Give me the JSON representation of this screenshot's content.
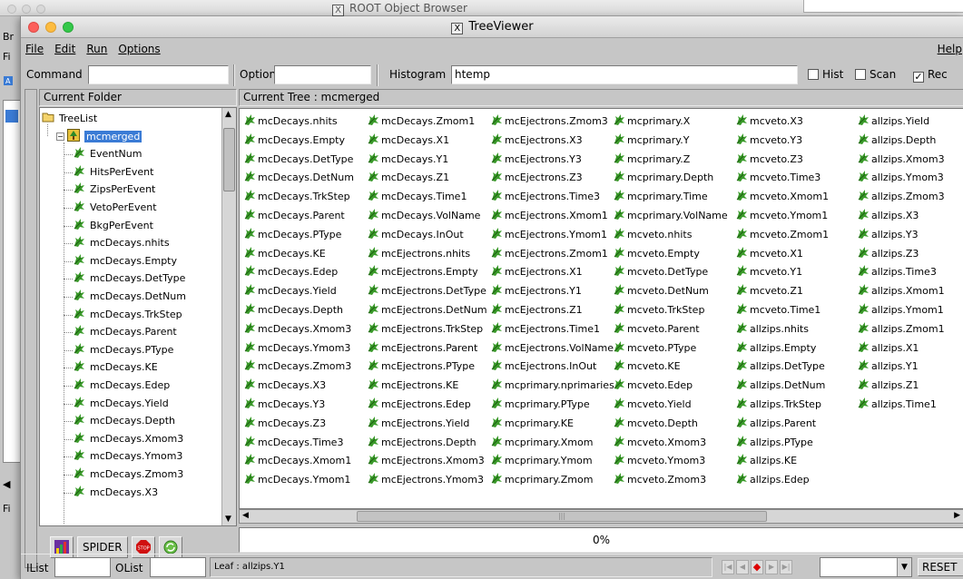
{
  "background_window": {
    "title": "ROOT Object Browser",
    "edge_labels": [
      "Br",
      "Fi",
      "Fi"
    ]
  },
  "window": {
    "title": "TreeViewer"
  },
  "menubar": {
    "file": "File",
    "edit": "Edit",
    "run": "Run",
    "options": "Options",
    "help": "Help"
  },
  "command_bar": {
    "command_label": "Command",
    "command_value": "",
    "option_label": "Option",
    "option_value": "",
    "histogram_label": "Histogram",
    "histogram_value": "htemp",
    "hist_label": "Hist",
    "hist_checked": false,
    "scan_label": "Scan",
    "scan_checked": false,
    "rec_label": "Rec",
    "rec_checked": true
  },
  "left_panel": {
    "header": "Current Folder",
    "tree": [
      {
        "label": "TreeList",
        "level": 0,
        "icon": "folder-icon"
      },
      {
        "label": "mcmerged",
        "level": 1,
        "icon": "tree-icon",
        "selected": true
      },
      {
        "label": "EventNum",
        "level": 2,
        "icon": "leaf-icon"
      },
      {
        "label": "HitsPerEvent",
        "level": 2,
        "icon": "leaf-icon"
      },
      {
        "label": "ZipsPerEvent",
        "level": 2,
        "icon": "leaf-icon"
      },
      {
        "label": "VetoPerEvent",
        "level": 2,
        "icon": "leaf-icon"
      },
      {
        "label": "BkgPerEvent",
        "level": 2,
        "icon": "leaf-icon"
      },
      {
        "label": "mcDecays.nhits",
        "level": 2,
        "icon": "leaf-icon"
      },
      {
        "label": "mcDecays.Empty",
        "level": 2,
        "icon": "leaf-icon"
      },
      {
        "label": "mcDecays.DetType",
        "level": 2,
        "icon": "leaf-icon"
      },
      {
        "label": "mcDecays.DetNum",
        "level": 2,
        "icon": "leaf-icon"
      },
      {
        "label": "mcDecays.TrkStep",
        "level": 2,
        "icon": "leaf-icon"
      },
      {
        "label": "mcDecays.Parent",
        "level": 2,
        "icon": "leaf-icon"
      },
      {
        "label": "mcDecays.PType",
        "level": 2,
        "icon": "leaf-icon"
      },
      {
        "label": "mcDecays.KE",
        "level": 2,
        "icon": "leaf-icon"
      },
      {
        "label": "mcDecays.Edep",
        "level": 2,
        "icon": "leaf-icon"
      },
      {
        "label": "mcDecays.Yield",
        "level": 2,
        "icon": "leaf-icon"
      },
      {
        "label": "mcDecays.Depth",
        "level": 2,
        "icon": "leaf-icon"
      },
      {
        "label": "mcDecays.Xmom3",
        "level": 2,
        "icon": "leaf-icon"
      },
      {
        "label": "mcDecays.Ymom3",
        "level": 2,
        "icon": "leaf-icon"
      },
      {
        "label": "mcDecays.Zmom3",
        "level": 2,
        "icon": "leaf-icon"
      },
      {
        "label": "mcDecays.X3",
        "level": 2,
        "icon": "leaf-icon"
      }
    ],
    "spider_label": "SPIDER"
  },
  "right_panel": {
    "header": "Current Tree : mcmerged",
    "columns": [
      [
        "mcDecays.nhits",
        "mcDecays.Empty",
        "mcDecays.DetType",
        "mcDecays.DetNum",
        "mcDecays.TrkStep",
        "mcDecays.Parent",
        "mcDecays.PType",
        "mcDecays.KE",
        "mcDecays.Edep",
        "mcDecays.Yield",
        "mcDecays.Depth",
        "mcDecays.Xmom3",
        "mcDecays.Ymom3",
        "mcDecays.Zmom3",
        "mcDecays.X3",
        "mcDecays.Y3",
        "mcDecays.Z3",
        "mcDecays.Time3",
        "mcDecays.Xmom1",
        "mcDecays.Ymom1"
      ],
      [
        "mcDecays.Zmom1",
        "mcDecays.X1",
        "mcDecays.Y1",
        "mcDecays.Z1",
        "mcDecays.Time1",
        "mcDecays.VolName",
        "mcDecays.InOut",
        "mcEjectrons.nhits",
        "mcEjectrons.Empty",
        "mcEjectrons.DetType",
        "mcEjectrons.DetNum",
        "mcEjectrons.TrkStep",
        "mcEjectrons.Parent",
        "mcEjectrons.PType",
        "mcEjectrons.KE",
        "mcEjectrons.Edep",
        "mcEjectrons.Yield",
        "mcEjectrons.Depth",
        "mcEjectrons.Xmom3",
        "mcEjectrons.Ymom3"
      ],
      [
        "mcEjectrons.Zmom3",
        "mcEjectrons.X3",
        "mcEjectrons.Y3",
        "mcEjectrons.Z3",
        "mcEjectrons.Time3",
        "mcEjectrons.Xmom1",
        "mcEjectrons.Ymom1",
        "mcEjectrons.Zmom1",
        "mcEjectrons.X1",
        "mcEjectrons.Y1",
        "mcEjectrons.Z1",
        "mcEjectrons.Time1",
        "mcEjectrons.VolName",
        "mcEjectrons.InOut",
        "mcprimary.nprimaries",
        "mcprimary.PType",
        "mcprimary.KE",
        "mcprimary.Xmom",
        "mcprimary.Ymom",
        "mcprimary.Zmom"
      ],
      [
        "mcprimary.X",
        "mcprimary.Y",
        "mcprimary.Z",
        "mcprimary.Depth",
        "mcprimary.Time",
        "mcprimary.VolName",
        "mcveto.nhits",
        "mcveto.Empty",
        "mcveto.DetType",
        "mcveto.DetNum",
        "mcveto.TrkStep",
        "mcveto.Parent",
        "mcveto.PType",
        "mcveto.KE",
        "mcveto.Edep",
        "mcveto.Yield",
        "mcveto.Depth",
        "mcveto.Xmom3",
        "mcveto.Ymom3",
        "mcveto.Zmom3"
      ],
      [
        "mcveto.X3",
        "mcveto.Y3",
        "mcveto.Z3",
        "mcveto.Time3",
        "mcveto.Xmom1",
        "mcveto.Ymom1",
        "mcveto.Zmom1",
        "mcveto.X1",
        "mcveto.Y1",
        "mcveto.Z1",
        "mcveto.Time1",
        "allzips.nhits",
        "allzips.Empty",
        "allzips.DetType",
        "allzips.DetNum",
        "allzips.TrkStep",
        "allzips.Parent",
        "allzips.PType",
        "allzips.KE",
        "allzips.Edep"
      ],
      [
        "allzips.Yield",
        "allzips.Depth",
        "allzips.Xmom3",
        "allzips.Ymom3",
        "allzips.Zmom3",
        "allzips.X3",
        "allzips.Y3",
        "allzips.Z3",
        "allzips.Time3",
        "allzips.Xmom1",
        "allzips.Ymom1",
        "allzips.Zmom1",
        "allzips.X1",
        "allzips.Y1",
        "allzips.Z1",
        "allzips.Time1"
      ]
    ]
  },
  "progress": {
    "value": 0,
    "label": "0%"
  },
  "statusbar": {
    "ilist_label": "IList",
    "olist_label": "OList",
    "leaf_text": "Leaf : allzips.Y1",
    "reset_label": "RESET"
  },
  "colors": {
    "selection": "#3a7bd5",
    "leaf_icon": "#3a9a2a",
    "background": "#c6c6c6"
  }
}
